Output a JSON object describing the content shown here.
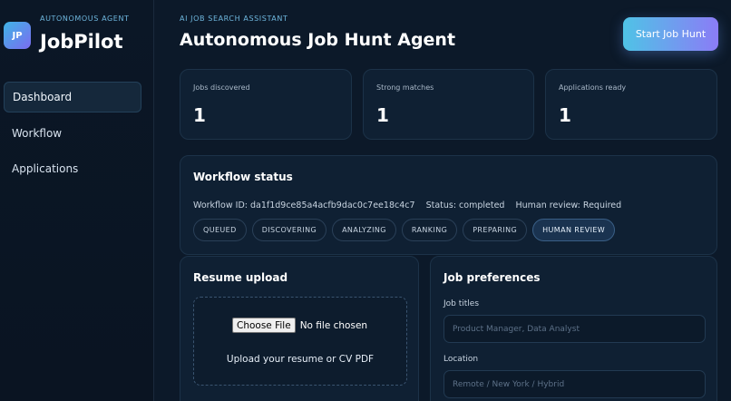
{
  "sidebar": {
    "logo_initials": "JP",
    "kicker": "AUTONOMOUS AGENT",
    "brand": "JobPilot",
    "nav": [
      {
        "label": "Dashboard",
        "active": true
      },
      {
        "label": "Workflow",
        "active": false
      },
      {
        "label": "Applications",
        "active": false
      }
    ]
  },
  "header": {
    "kicker": "AI JOB SEARCH ASSISTANT",
    "title": "Autonomous Job Hunt Agent",
    "start_button": "Start Job Hunt"
  },
  "stats": [
    {
      "label": "Jobs discovered",
      "value": "1"
    },
    {
      "label": "Strong matches",
      "value": "1"
    },
    {
      "label": "Applications ready",
      "value": "1"
    }
  ],
  "workflow": {
    "title": "Workflow status",
    "id_text": "Workflow ID: da1f1d9ce85a4acfb9dac0c7ee18c4c7",
    "status_text": "Status: completed",
    "review_text": "Human review: Required",
    "steps": [
      "QUEUED",
      "DISCOVERING",
      "ANALYZING",
      "RANKING",
      "PREPARING",
      "HUMAN REVIEW"
    ],
    "current_step": "HUMAN REVIEW"
  },
  "resume": {
    "title": "Resume upload",
    "file_button": "Choose File",
    "file_status": "No file chosen",
    "hint": "Upload your resume or CV PDF"
  },
  "preferences": {
    "title": "Job preferences",
    "job_titles_label": "Job titles",
    "job_titles_placeholder": "Product Manager, Data Analyst",
    "location_label": "Location",
    "location_placeholder": "Remote / New York / Hybrid"
  },
  "colors": {
    "background": "#0c1929",
    "card": "#0f2033",
    "accent_start": "#4fc3e6",
    "accent_end": "#8b7cf6"
  }
}
